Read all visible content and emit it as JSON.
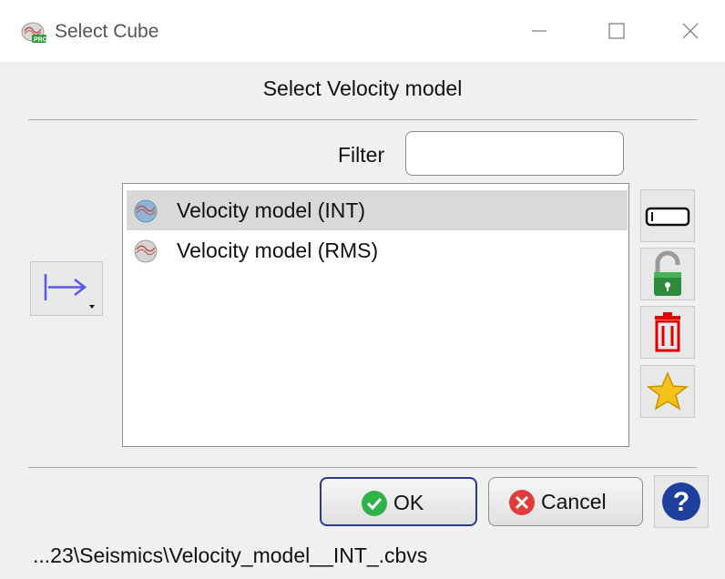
{
  "window": {
    "title": "Select Cube",
    "icon": "pro-cube-app-icon",
    "controls": [
      "minimize-icon",
      "maximize-icon",
      "close-icon"
    ]
  },
  "heading": "Select Velocity model",
  "filter": {
    "label": "Filter",
    "value": "",
    "placeholder": ""
  },
  "list": {
    "items": [
      {
        "label": "Velocity model (INT)",
        "selected": true,
        "icon": "velocity-cube-icon"
      },
      {
        "label": "Velocity model (RMS)",
        "selected": false,
        "icon": "velocity-cube-icon"
      }
    ]
  },
  "side_tools": [
    "rename-icon",
    "unlock-icon",
    "delete-icon",
    "favorite-star-icon"
  ],
  "left_tool": "insert-arrow-icon",
  "buttons": {
    "ok_label": "OK",
    "cancel_label": "Cancel",
    "help": "help-icon"
  },
  "status_path": "...23\\Seismics\\Velocity_model__INT_.cbvs",
  "colors": {
    "selection": "#d9d9d9",
    "ok_border": "#2b3a8c",
    "help_blue": "#1d3f9e",
    "delete_red": "#e00000",
    "arrow_blue": "#5a56f5"
  }
}
